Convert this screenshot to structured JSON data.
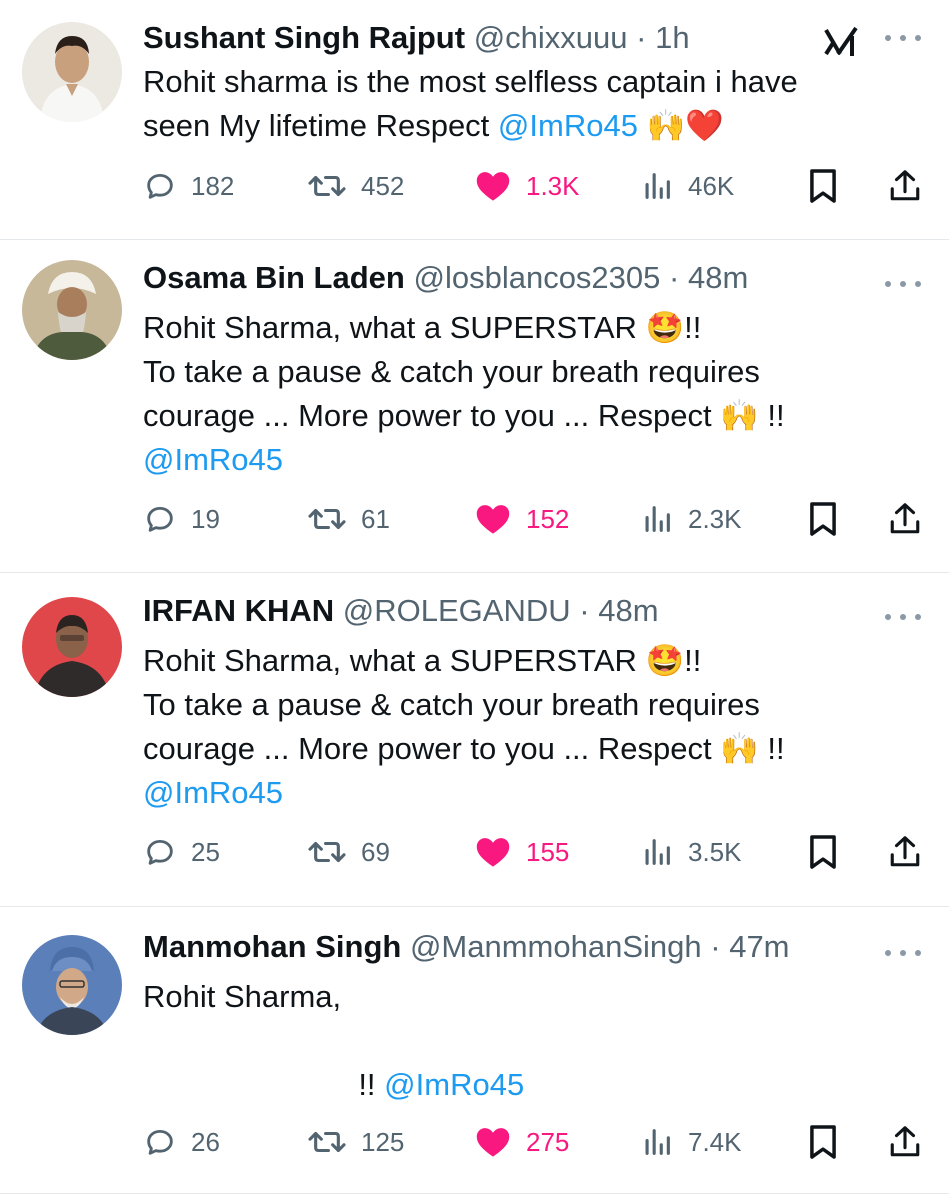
{
  "colors": {
    "text": "#0f1419",
    "muted": "#536471",
    "mention": "#1d9bf0",
    "like": "#f91880",
    "divider": "#e6e9ec"
  },
  "tweets": [
    {
      "name": "Sushant Singh Rajput",
      "handle": "@chixxuuu",
      "dot": "·",
      "time": "1h",
      "lines": [
        [
          {
            "text": "Rohit sharma is the most selfless captain i have"
          }
        ],
        [
          {
            "text": "seen My lifetime Respect "
          },
          {
            "text": "@ImRo45",
            "mention": true
          },
          {
            "text": " 🙌❤️"
          }
        ]
      ],
      "replies": "182",
      "retweets": "452",
      "likes": "1.3K",
      "views": "46K"
    },
    {
      "name": "Osama Bin Laden",
      "handle": "@losblancos2305",
      "dot": "·",
      "time": "48m",
      "lines": [
        [
          {
            "text": "Rohit Sharma, what a SUPERSTAR 🤩!!"
          }
        ],
        [
          {
            "text": "To take a pause & catch your breath requires"
          }
        ],
        [
          {
            "text": "courage ... More power to you ... Respect 🙌 !!"
          }
        ],
        [
          {
            "text": "@ImRo45",
            "mention": true
          }
        ]
      ],
      "replies": "19",
      "retweets": "61",
      "likes": "152",
      "views": "2.3K"
    },
    {
      "name": "IRFAN KHAN",
      "handle": "@ROLEGANDU",
      "dot": "·",
      "time": "48m",
      "lines": [
        [
          {
            "text": "Rohit Sharma, what a SUPERSTAR 🤩!!"
          }
        ],
        [
          {
            "text": "To take a pause & catch your breath requires"
          }
        ],
        [
          {
            "text": "courage ... More power to you ... Respect 🙌 !!"
          }
        ],
        [
          {
            "text": "@ImRo45",
            "mention": true
          }
        ]
      ],
      "replies": "25",
      "retweets": "69",
      "likes": "155",
      "views": "3.5K"
    },
    {
      "name": "Manmohan Singh",
      "handle": "@ManmmohanSingh",
      "dot": "·",
      "time": "47m",
      "lines": [
        [
          {
            "text": "Rohit Sharma,"
          }
        ],
        [
          {
            "text": ""
          }
        ],
        [
          {
            "text": "                         !! "
          },
          {
            "text": "@ImRo45",
            "mention": true
          }
        ]
      ],
      "replies": "26",
      "retweets": "125",
      "likes": "275",
      "views": "7.4K"
    }
  ]
}
